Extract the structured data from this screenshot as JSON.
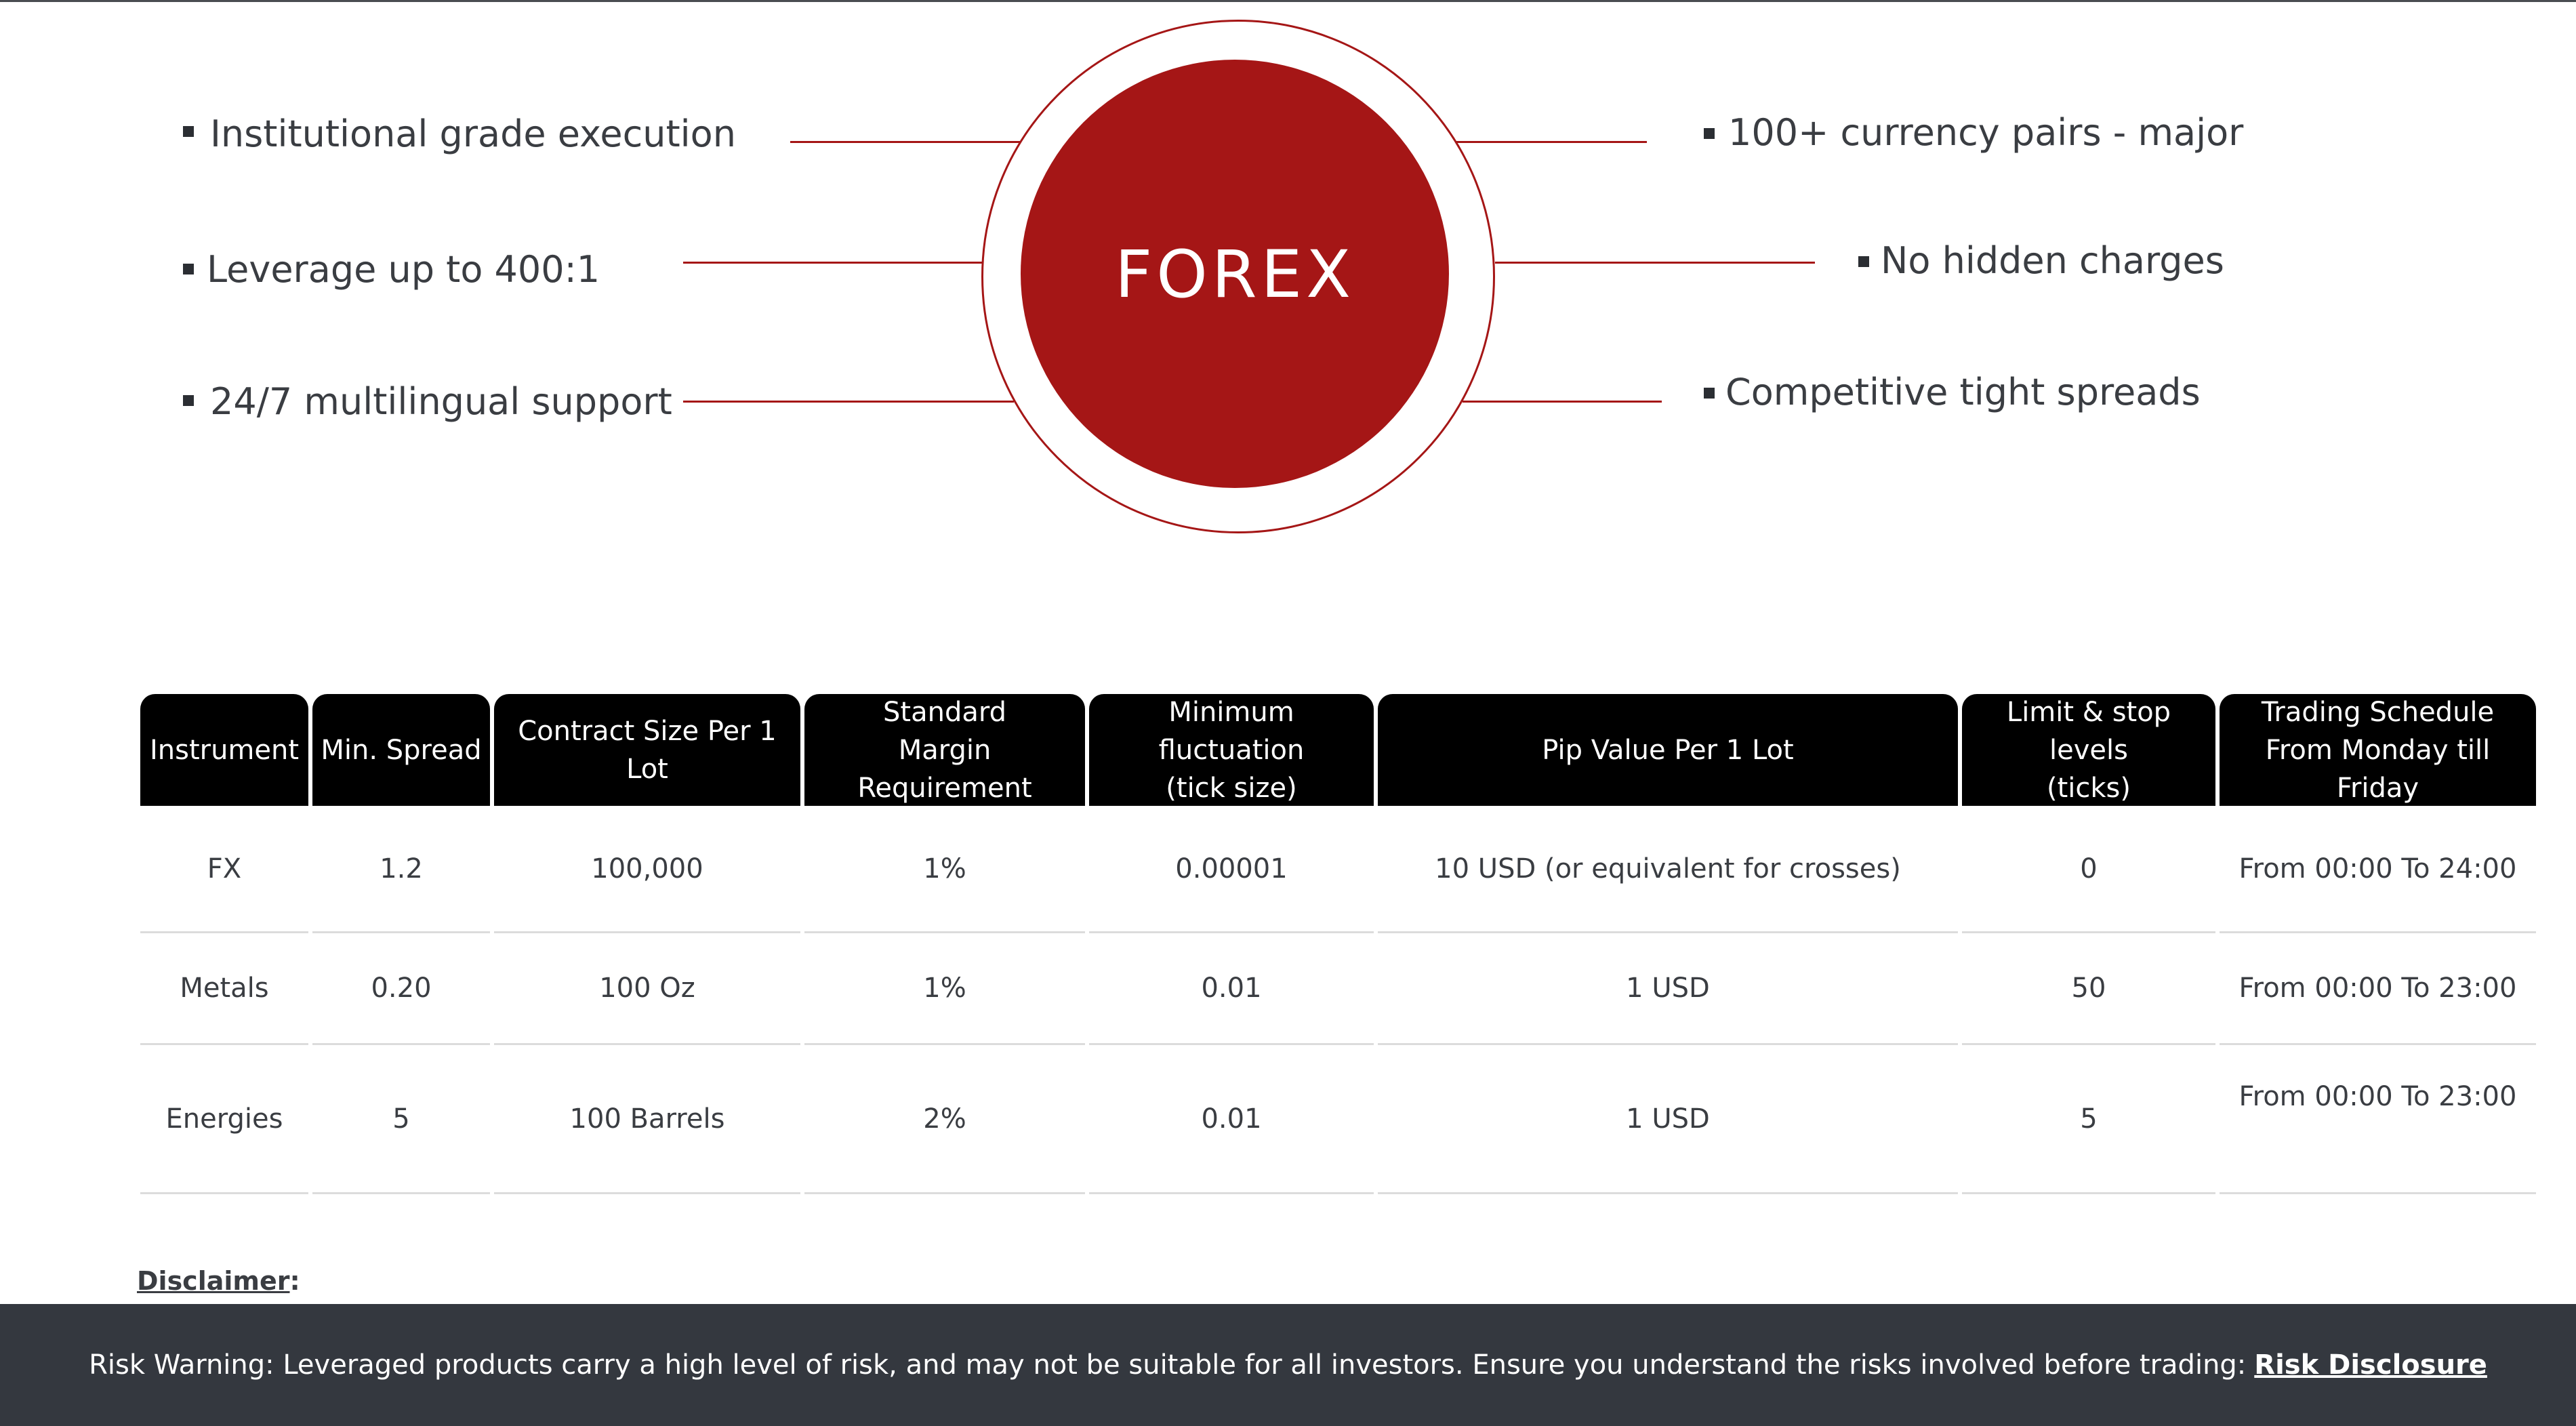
{
  "diagram": {
    "center_label": "FOREX",
    "left_features": [
      "Institutional grade execution",
      "Leverage up to 400:1",
      "24/7 multilingual support"
    ],
    "right_features": [
      "100+ currency pairs - major",
      "No hidden charges",
      "Competitive tight spreads"
    ],
    "accent_color": "#a51616"
  },
  "table": {
    "headers": [
      "Instrument",
      "Min. Spread",
      "Contract Size Per 1 Lot",
      "Standard\nMargin Requirement",
      "Minimum fluctuation\n(tick size)",
      "Pip Value Per 1 Lot",
      "Limit & stop levels\n(ticks)",
      "Trading Schedule\nFrom Monday till Friday"
    ],
    "rows": [
      [
        "FX",
        "1.2",
        "100,000",
        "1%",
        "0.00001",
        "10 USD (or equivalent for crosses)",
        "0",
        "From 00:00 To 24:00"
      ],
      [
        "Metals",
        "0.20",
        "100 Oz",
        "1%",
        "0.01",
        "1 USD",
        "50",
        "From 00:00 To 23:00"
      ],
      [
        "Energies",
        "5",
        "100 Barrels",
        "2%",
        "0.01",
        "1 USD",
        "5",
        "From 00:00 To 23:00"
      ]
    ]
  },
  "disclaimer": {
    "label": "Disclaimer",
    "suffix": ":"
  },
  "risk_bar": {
    "text": "Risk Warning: Leveraged products carry a high level of risk, and may not be suitable for all investors. Ensure you understand the risks involved before trading:",
    "link_label": "Risk Disclosure"
  }
}
